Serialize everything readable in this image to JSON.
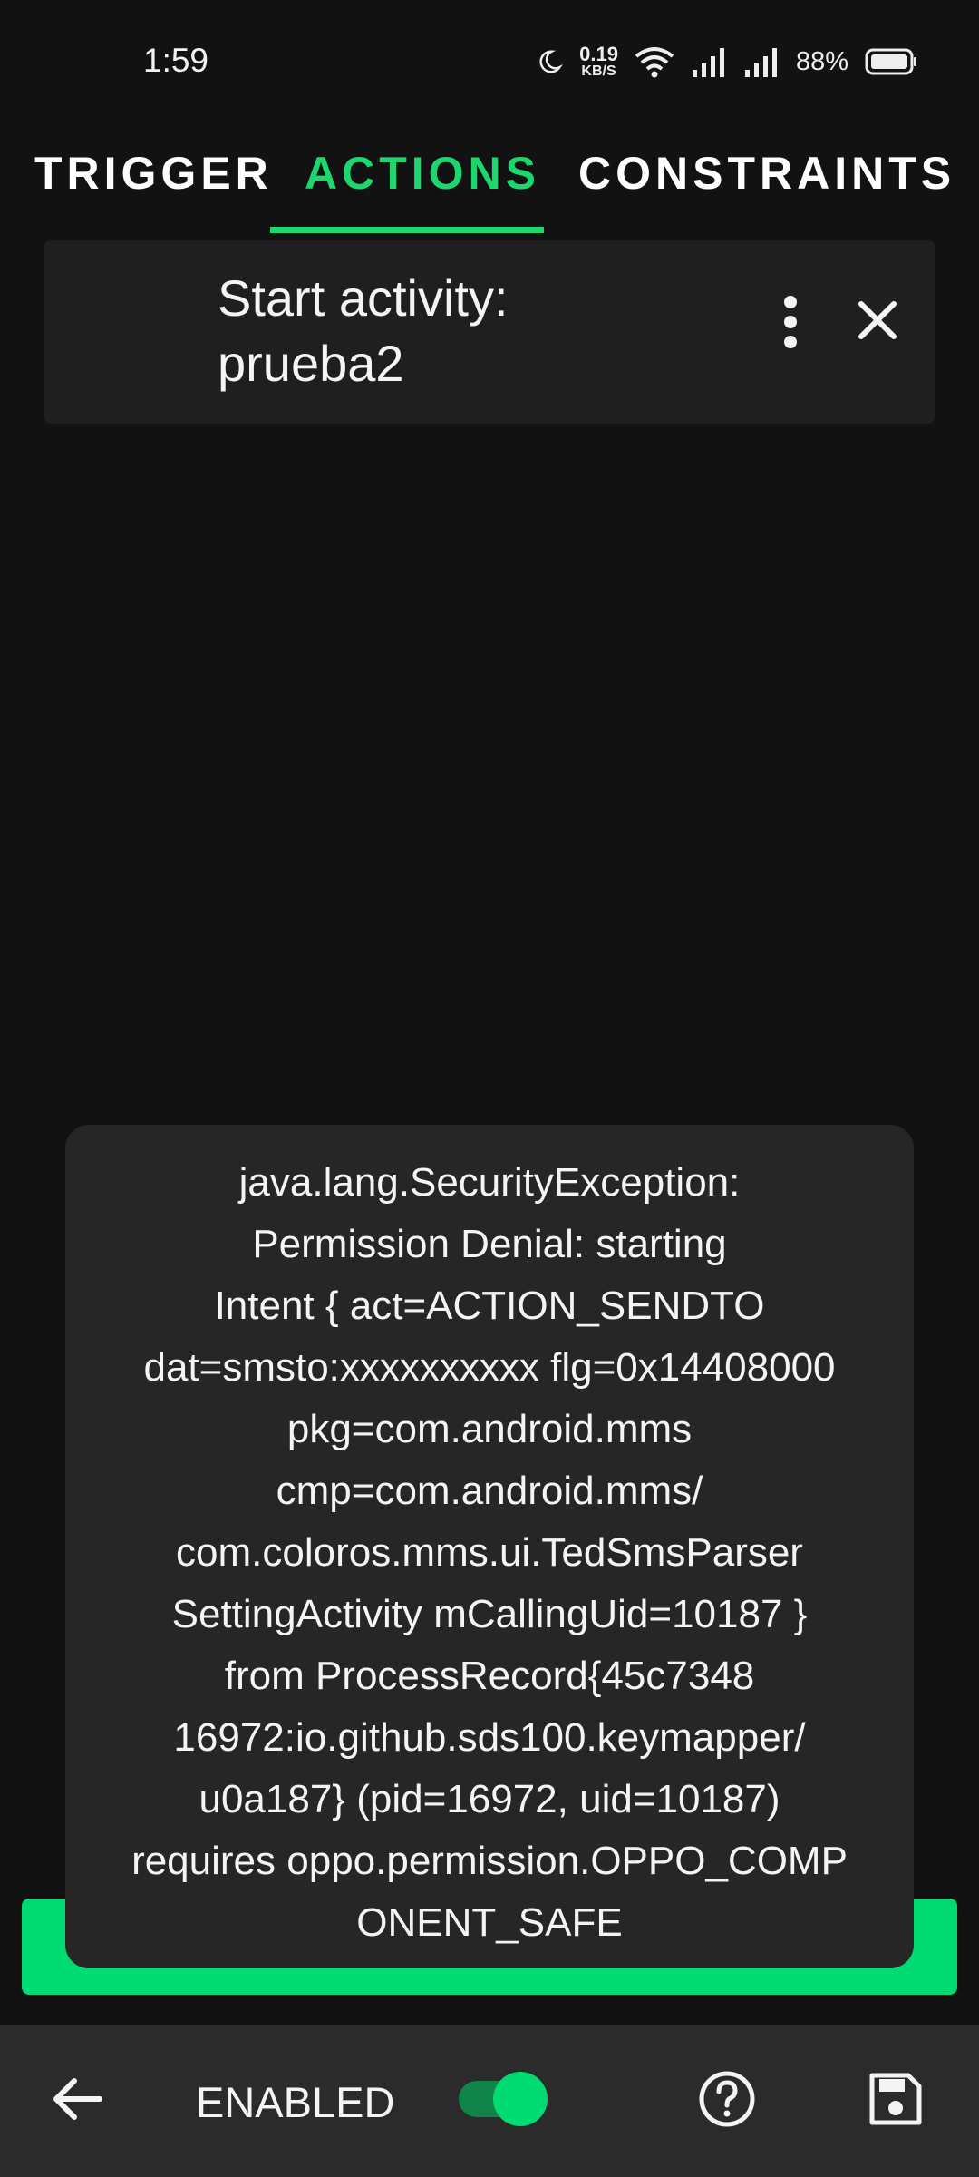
{
  "status_bar": {
    "time": "1:59",
    "net_speed_value": "0.19",
    "net_speed_unit": "KB/S",
    "battery_percent": "88%"
  },
  "tabs": [
    {
      "label": "TRIGGER",
      "active": false
    },
    {
      "label": "ACTIONS",
      "active": true
    },
    {
      "label": "CONSTRAINTS",
      "active": false
    }
  ],
  "action_card": {
    "title": "Start activity: prueba2"
  },
  "toast": {
    "message": "java.lang.SecurityException:\nPermission Denial: starting\nIntent { act=ACTION_SENDTO\ndat=smsto:xxxxxxxxxx flg=0x14408000\npkg=com.android.mms\ncmp=com.android.mms/\ncom.coloros.mms.ui.TedSmsParser\nSettingActivity mCallingUid=10187 }\nfrom ProcessRecord{45c7348\n16972:io.github.sds100.keymapper/\nu0a187} (pid=16972, uid=10187)\nrequires oppo.permission.OPPO_COMP\nONENT_SAFE"
  },
  "bottom_bar": {
    "enabled_label": "ENABLED",
    "enabled": true
  },
  "colors": {
    "accent": "#1ed66e",
    "background": "#121212",
    "card": "#1f1f1f",
    "toast": "#262626",
    "bottom_bar": "#2b2b2b"
  }
}
